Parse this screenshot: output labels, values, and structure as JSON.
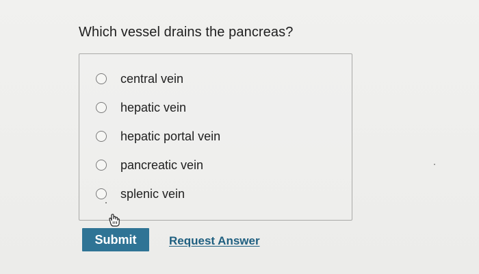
{
  "question": {
    "text": "Which vessel drains the pancreas?"
  },
  "options": [
    {
      "label": "central vein",
      "selected": false
    },
    {
      "label": "hepatic vein",
      "selected": false
    },
    {
      "label": "hepatic portal vein",
      "selected": false
    },
    {
      "label": "pancreatic vein",
      "selected": false
    },
    {
      "label": "splenic vein",
      "selected": false
    }
  ],
  "actions": {
    "submit_label": "Submit",
    "request_answer_label": "Request Answer"
  },
  "colors": {
    "submit_background": "#2f7495",
    "link": "#1f5f80",
    "panel_border": "#a9a9a7"
  },
  "icons": {
    "radio": "radio-button-icon",
    "cursor": "hand-pointer-icon"
  }
}
